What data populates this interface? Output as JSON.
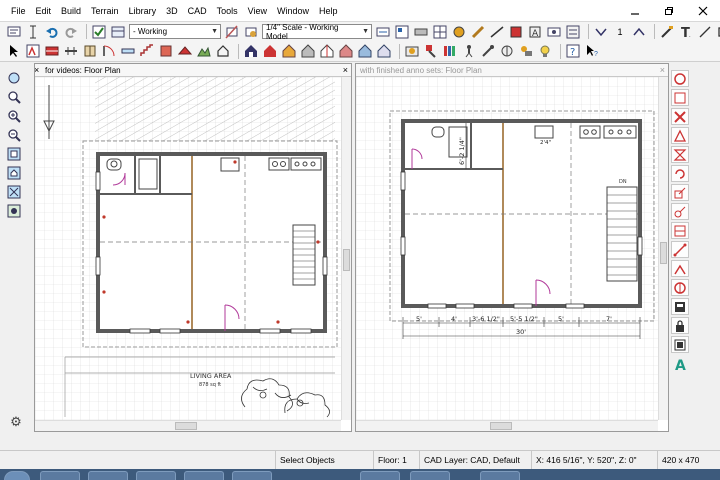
{
  "menu": [
    "File",
    "Edit",
    "Build",
    "Terrain",
    "Library",
    "3D",
    "CAD",
    "Tools",
    "View",
    "Window",
    "Help"
  ],
  "toolbar": {
    "layer_set": "- Working",
    "scale": "1/4\" Scale - Working Model",
    "counter": "1"
  },
  "left_view": {
    "title": "for videos: Floor Plan",
    "room_label": "LIVING AREA",
    "room_area": "878 sq ft"
  },
  "right_view": {
    "title": "with finished anno sets: Floor Plan",
    "dims_bottom": [
      "5'",
      "4'",
      "3'-6 1/2\"",
      "5'-5 1/2\"",
      "5'",
      "7'"
    ],
    "dim_total": "30'",
    "dim_vertical": "6'-2 1/4\"",
    "dim_small": "2'4\"",
    "dn_label": "DN"
  },
  "status": {
    "mode": "Select Objects",
    "floor": "Floor: 1",
    "cad_layer": "CAD Layer: CAD,  Default",
    "coords": "X: 416 5/16\", Y: 520\", Z: 0\"",
    "view_size": "420 x 470"
  },
  "colors": {
    "wall": "#5a5a5a",
    "wall_fill": "#8c8c8c",
    "grid": "#dadada",
    "dim": "#333333",
    "accent": "#c0392b"
  }
}
